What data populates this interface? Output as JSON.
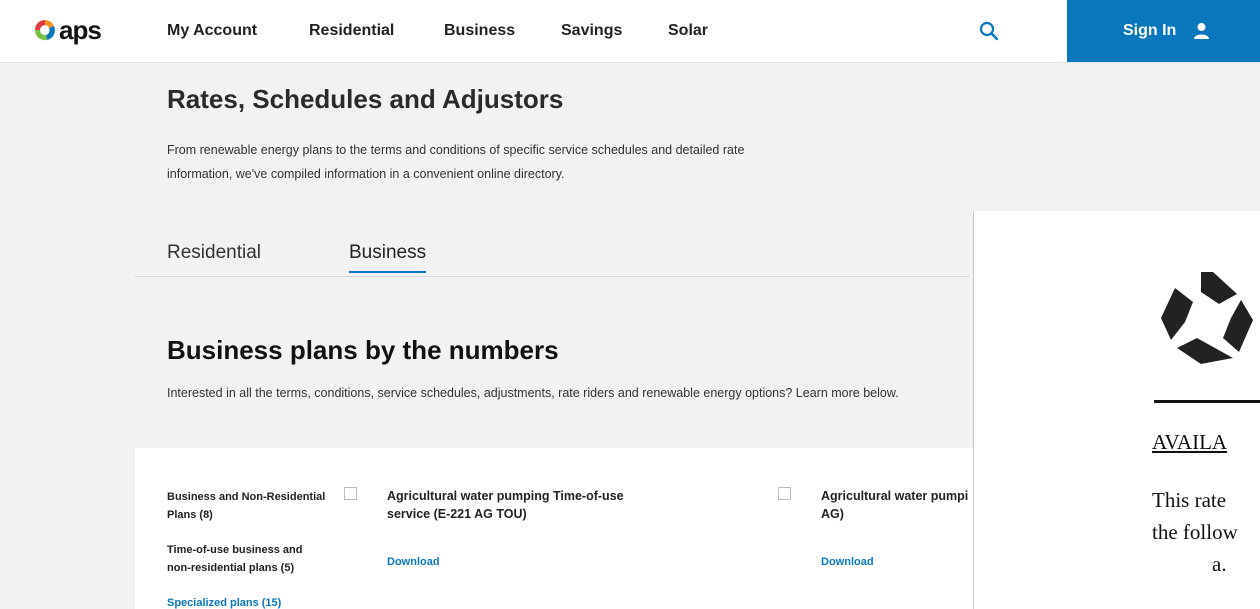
{
  "header": {
    "logo_text": "aps",
    "nav": [
      "My Account",
      "Residential",
      "Business",
      "Savings",
      "Solar"
    ],
    "search_icon": "search-icon",
    "signin_label": "Sign In",
    "signin_icon": "user-icon",
    "accent": "#0a77bd"
  },
  "page": {
    "title": "Rates, Schedules and Adjustors",
    "intro": "From renewable energy plans to the terms and conditions of specific service schedules and detailed rate information, we've compiled information in a convenient online directory."
  },
  "tabs": [
    {
      "label": "Residential",
      "active": false
    },
    {
      "label": "Business",
      "active": true
    }
  ],
  "section": {
    "title": "Business plans by the numbers",
    "subtitle": "Interested in all the terms, conditions, service schedules, adjustments, rate riders and renewable energy options? Learn more below."
  },
  "filters": [
    {
      "label": "Business and Non-Residential Plans (8)"
    },
    {
      "label": "Time-of-use business and non-residential plans (5)"
    },
    {
      "label": "Specialized plans (15)"
    }
  ],
  "cards": [
    {
      "title": "Agricultural water pumping Time-of-use service (E-221 AG TOU)",
      "download": "Download"
    },
    {
      "title": "Agricultural water pumpi AG)",
      "download": "Download"
    }
  ],
  "document": {
    "heading": "AVAILA",
    "lines": [
      "This rate",
      "the follow",
      "a."
    ]
  }
}
